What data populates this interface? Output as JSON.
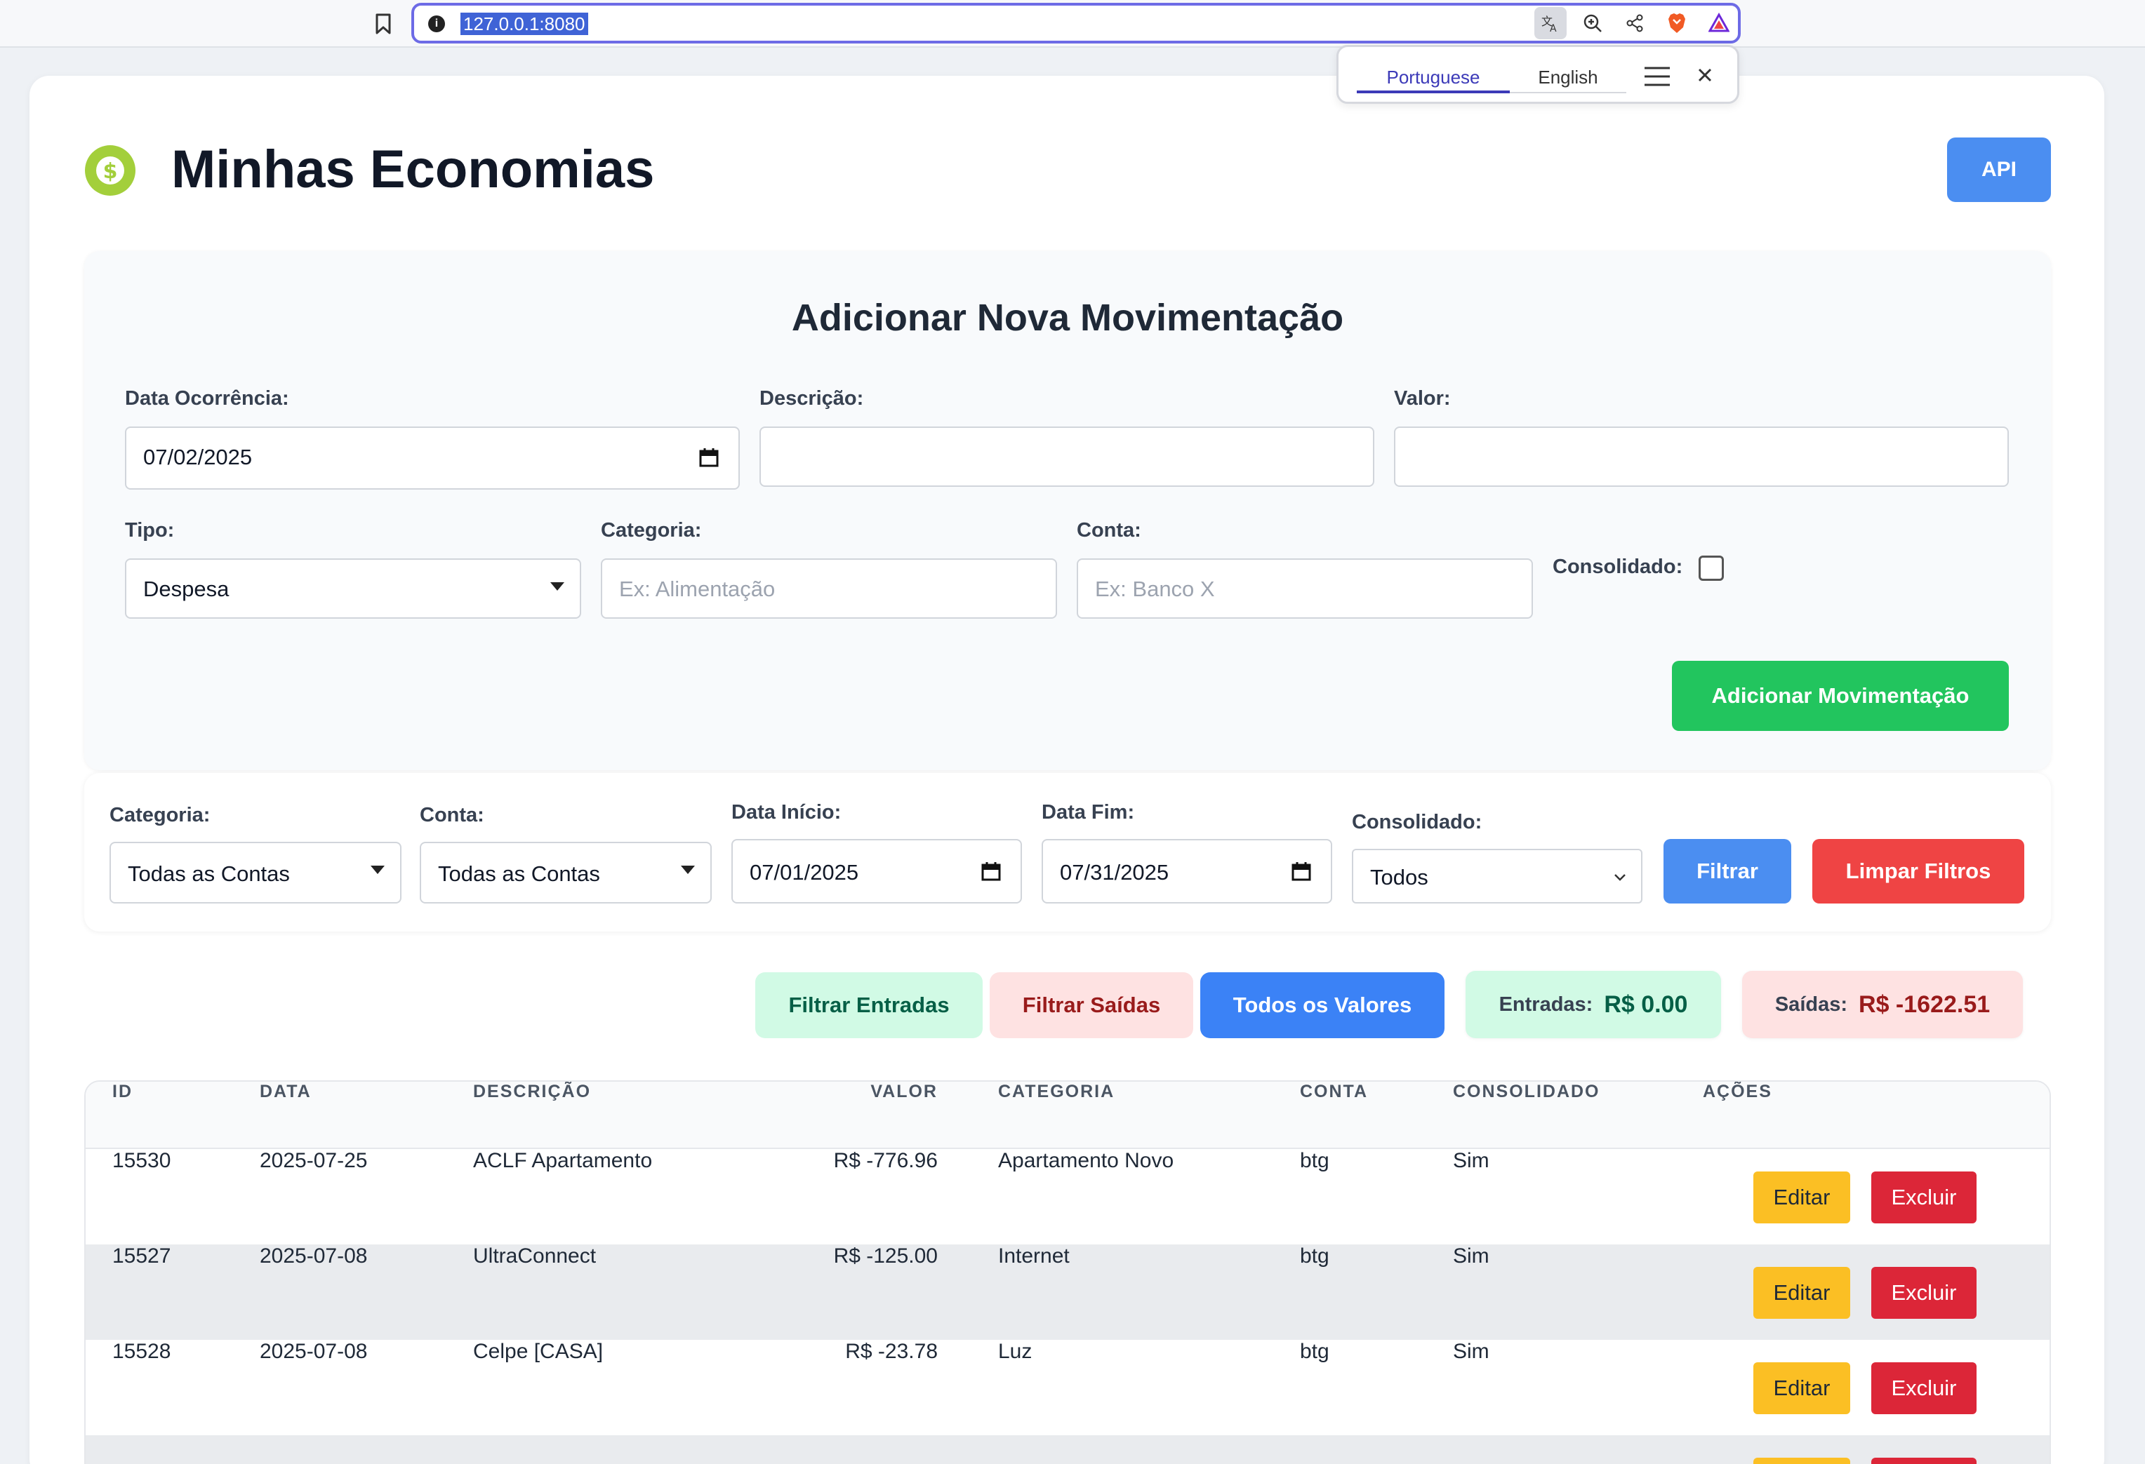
{
  "browser": {
    "url": "127.0.0.1:8080",
    "icons": [
      "bookmark-icon",
      "info-icon",
      "translate-icon",
      "zoom-icon",
      "share-icon",
      "brave-shield-icon",
      "brave-rewards-icon"
    ]
  },
  "translate_popup": {
    "languages": [
      "Portuguese",
      "English"
    ],
    "selected": "Portuguese"
  },
  "header": {
    "title": "Minhas Economias",
    "api_label": "API",
    "logo_icon": "dollar-coin-icon",
    "logo_color": "#a3cf3b"
  },
  "form": {
    "title": "Adicionar Nova Movimentação",
    "date_label": "Data Ocorrência:",
    "date_value": "07/02/2025",
    "description_label": "Descrição:",
    "description_value": "",
    "value_label": "Valor:",
    "value_value": "",
    "type_label": "Tipo:",
    "type_value": "Despesa",
    "category_label": "Categoria:",
    "category_placeholder": "Ex: Alimentação",
    "account_label": "Conta:",
    "account_placeholder": "Ex: Banco X",
    "consolidated_label": "Consolidado:",
    "consolidated_checked": false,
    "submit_label": "Adicionar Movimentação"
  },
  "filters": {
    "category_label": "Categoria:",
    "category_value": "Todas as Contas",
    "account_label": "Conta:",
    "account_value": "Todas as Contas",
    "start_label": "Data Início:",
    "start_value": "07/01/2025",
    "end_label": "Data Fim:",
    "end_value": "07/31/2025",
    "consolidated_label": "Consolidado:",
    "consolidated_value": "Todos",
    "filter_label": "Filtrar",
    "clear_label": "Limpar Filtros"
  },
  "quick": {
    "in_label": "Filtrar Entradas",
    "out_label": "Filtrar Saídas",
    "all_label": "Todos os Valores",
    "sum_in_label": "Entradas:",
    "sum_in_value": "R$ 0.00",
    "sum_out_label": "Saídas:",
    "sum_out_value": "R$ -1622.51"
  },
  "table": {
    "headers": [
      "ID",
      "DATA",
      "DESCRIÇÃO",
      "VALOR",
      "CATEGORIA",
      "CONTA",
      "CONSOLIDADO",
      "AÇÕES"
    ],
    "edit_label": "Editar",
    "delete_label": "Excluir",
    "rows": [
      {
        "id": "15530",
        "date": "2025-07-25",
        "description": "ACLF Apartamento",
        "value": "R$ -776.96",
        "category": "Apartamento Novo",
        "account": "btg",
        "consolidated": "Sim"
      },
      {
        "id": "15527",
        "date": "2025-07-08",
        "description": "UltraConnect",
        "value": "R$ -125.00",
        "category": "Internet",
        "account": "btg",
        "consolidated": "Sim"
      },
      {
        "id": "15528",
        "date": "2025-07-08",
        "description": "Celpe [CASA]",
        "value": "R$ -23.78",
        "category": "Luz",
        "account": "btg",
        "consolidated": "Sim"
      },
      {
        "id": "",
        "date": "",
        "description": "",
        "value": "",
        "category": "",
        "account": "",
        "consolidated": ""
      }
    ]
  },
  "colors": {
    "primary_blue": "#4b8ef1",
    "success_green": "#22c55e",
    "danger_red": "#ef4444",
    "edit_yellow": "#fbbf24",
    "delete_red": "#dc2638"
  }
}
